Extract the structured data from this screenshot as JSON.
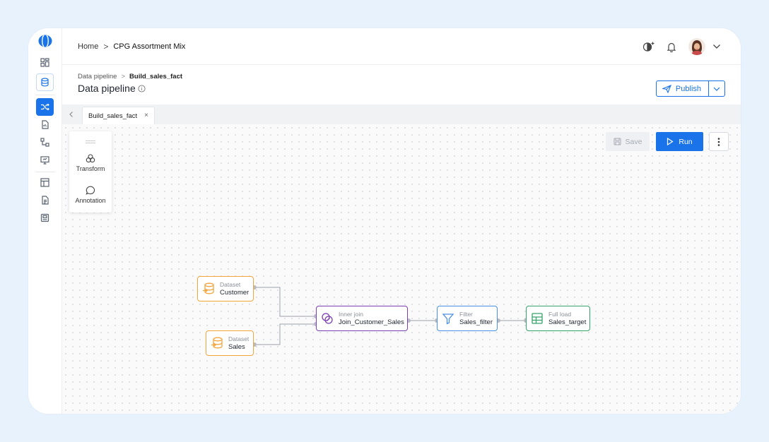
{
  "topbar": {
    "crumbs": [
      "Home",
      "CPG Assortment Mix"
    ],
    "separator": ">"
  },
  "page": {
    "breadcrumb": [
      "Data pipeline",
      "Build_sales_fact"
    ],
    "separator": ">",
    "title": "Data pipeline",
    "publish_label": "Publish"
  },
  "tabs": [
    {
      "label": "Build_sales_fact",
      "close": "×"
    }
  ],
  "palette": {
    "transform_label": "Transform",
    "annotation_label": "Annotation"
  },
  "toolbar": {
    "save_label": "Save",
    "run_label": "Run"
  },
  "nodes": {
    "customer": {
      "type": "Dataset",
      "name": "Customer"
    },
    "sales": {
      "type": "Dataset",
      "name": "Sales"
    },
    "join": {
      "type": "Inner join",
      "name": "Join_Customer_Sales"
    },
    "filter": {
      "type": "Filter",
      "name": "Sales_filter"
    },
    "target": {
      "type": "Full load",
      "name": "Sales_target"
    }
  },
  "colors": {
    "accent": "#1a73e8",
    "dataset": "#f3a53c",
    "join": "#7a3fb0",
    "filter": "#4a8fe6",
    "load": "#35a46a",
    "background": "#e8f2fc"
  },
  "icons": {
    "rail": [
      "home-grid-icon",
      "database-icon",
      "pipeline-icon",
      "document-chart-icon",
      "flow-icon",
      "monitor-icon",
      "table-icon",
      "report-icon",
      "storage-icon"
    ],
    "topbar": [
      "theme-toggle-icon",
      "bell-icon",
      "chevron-down-icon"
    ]
  }
}
